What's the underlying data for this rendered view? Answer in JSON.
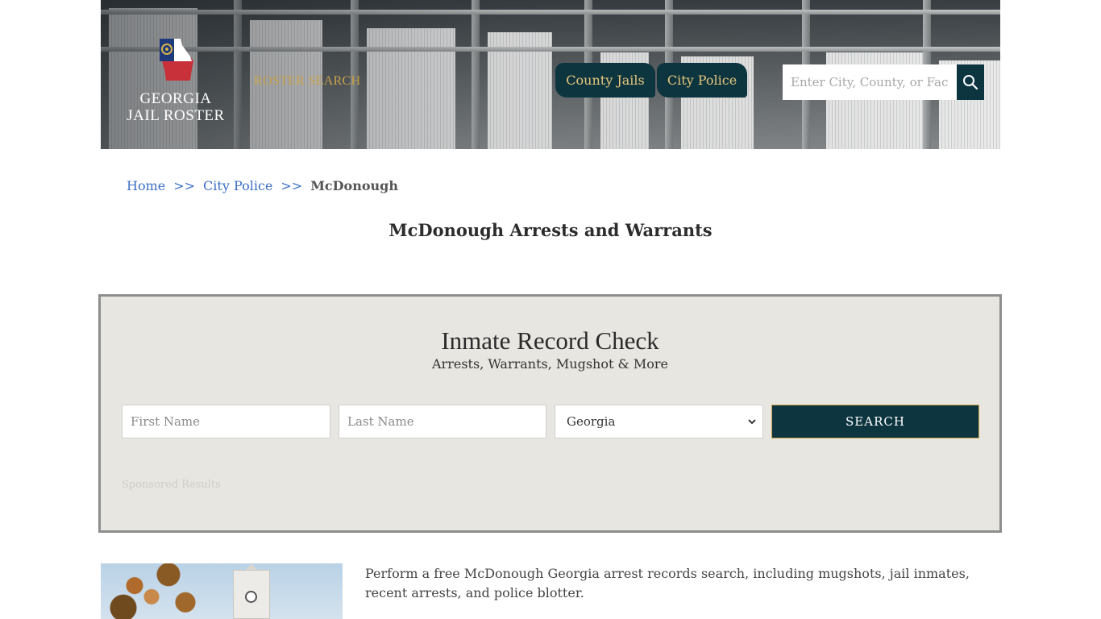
{
  "header": {
    "logo_text_line1": "GEORGIA",
    "logo_text_line2": "JAIL ROSTER",
    "roster_link": "ROSTER SEARCH",
    "nav": [
      {
        "label": "County Jails"
      },
      {
        "label": "City Police"
      }
    ],
    "search_placeholder": "Enter City, County, or Facil",
    "colors": {
      "nav_bg": "#0d3540",
      "nav_text": "#e7c77a",
      "roster_link": "#c9a24a"
    }
  },
  "breadcrumb": {
    "home": "Home",
    "sep": ">>",
    "parent": "City Police",
    "current": "McDonough"
  },
  "page_title": "McDonough Arrests and Warrants",
  "record_check": {
    "title": "Inmate Record Check",
    "subtitle": "Arrests, Warrants, Mugshot & More",
    "first_name_placeholder": "First Name",
    "last_name_placeholder": "Last Name",
    "state_selected": "Georgia",
    "search_label": "SEARCH",
    "sponsored": "Sponsored Results"
  },
  "intro_text": "Perform a free McDonough Georgia arrest records search, including mugshots, jail inmates, recent arrests, and police blotter."
}
